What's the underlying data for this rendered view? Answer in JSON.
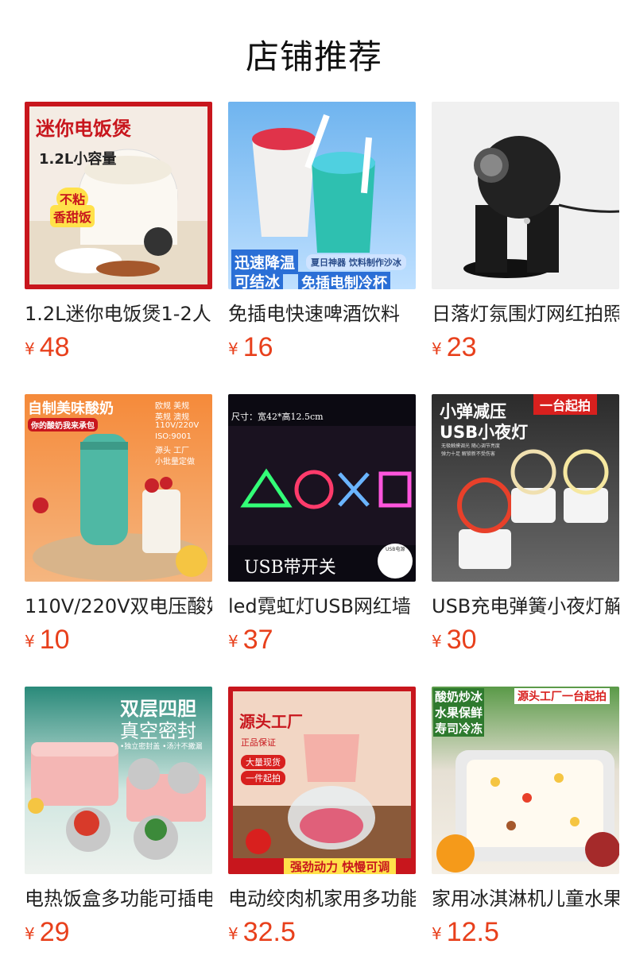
{
  "section_title": "店铺推荐",
  "currency_symbol": "¥",
  "products": [
    {
      "name": "1.2L迷你电饭煲1-2人",
      "price": "48",
      "image_texts": [
        "迷你电饭煲",
        "1.2L小容量",
        "不粘",
        "香甜饭"
      ]
    },
    {
      "name": "免插电快速啤酒饮料",
      "price": "16",
      "image_texts": [
        "迅速降温",
        "可结冰",
        "夏日神器 饮料制作沙冰",
        "免插电制冷杯"
      ]
    },
    {
      "name": "日落灯氛围灯网红拍照",
      "price": "23",
      "image_texts": []
    },
    {
      "name": "110V/220V双电压酸奶",
      "price": "10",
      "image_texts": [
        "自制美味酸奶",
        "你的酸奶我来承包",
        "欧规 美规",
        "英规 澳规",
        "110V/220V",
        "ISO:9001",
        "源头 工厂",
        "小批量定做"
      ]
    },
    {
      "name": "led霓虹灯USB网红墙",
      "price": "37",
      "image_texts": [
        "尺寸：宽42*高12.5cm",
        "USB带开关",
        "USB电源"
      ]
    },
    {
      "name": "USB充电弹簧小夜灯解压",
      "price": "30",
      "image_texts": [
        "小弹减压",
        "USB小夜灯",
        "一台起拍",
        "无极触摸调光 随心调节亮度",
        "弹力十足 解锁新不受伤害"
      ]
    },
    {
      "name": "电热饭盒多功能可插电",
      "price": "29",
      "image_texts": [
        "双层四胆",
        "真空密封",
        "•独立密封盖 •汤汁不撒漏"
      ]
    },
    {
      "name": "电动绞肉机家用多功能",
      "price": "32.5",
      "image_texts": [
        "源头工厂",
        "正品保证",
        "大量现货",
        "一件起拍",
        "强劲动力 快慢可调"
      ]
    },
    {
      "name": "家用冰淇淋机儿童水果",
      "price": "12.5",
      "image_texts": [
        "酸奶炒冰",
        "水果保鲜",
        "寿司冷冻",
        "源头工厂一台起拍"
      ]
    }
  ],
  "colors": {
    "price": "#e8401c",
    "title": "#111111"
  }
}
